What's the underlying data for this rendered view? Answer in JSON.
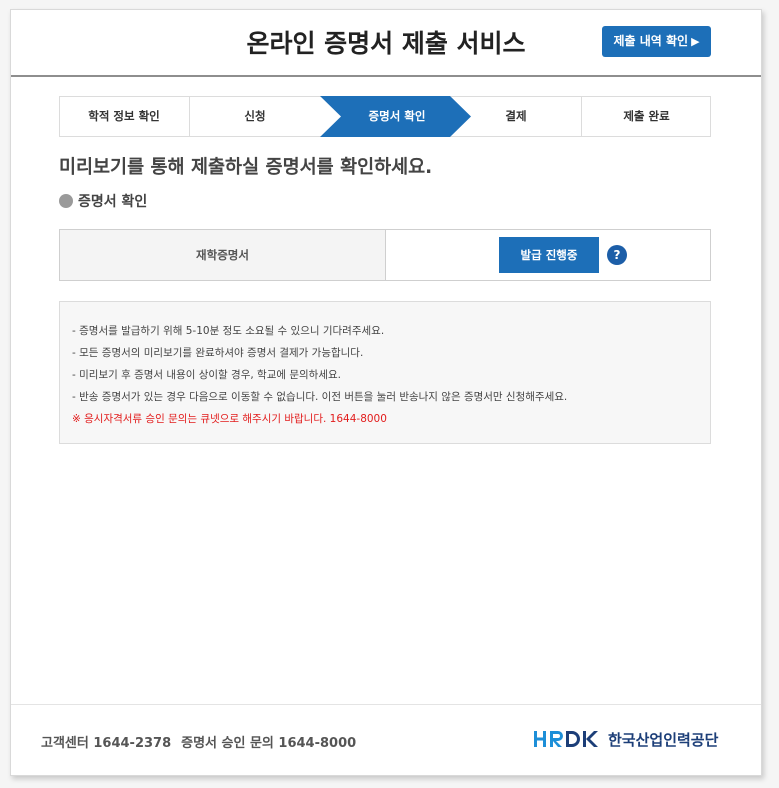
{
  "header": {
    "title": "온라인 증명서 제출 서비스",
    "history_button": "제출 내역 확인",
    "history_arrow": "▶"
  },
  "steps": [
    {
      "label": "학적 정보 확인",
      "active": false
    },
    {
      "label": "신청",
      "active": false
    },
    {
      "label": "증명서 확인",
      "active": true
    },
    {
      "label": "결제",
      "active": false
    },
    {
      "label": "제출 완료",
      "active": false
    }
  ],
  "main": {
    "heading": "미리보기를 통해 제출하실 증명서를 확인하세요.",
    "section_title": "증명서 확인",
    "certificate": {
      "name": "재학증명서",
      "status": "발급 진행중",
      "help": "?"
    },
    "notices": [
      "- 증명서를 발급하기 위해 5-10분 정도 소요될 수 있으니 기다려주세요.",
      "- 모든 증명서의 미리보기를 완료하셔야 증명서 결제가 가능합니다.",
      "- 미리보기 후 증명서 내용이 상이할 경우, 학교에 문의하세요.",
      "- 반송 증명서가 있는 경우 다음으로 이동할 수 없습니다. 이전 버튼을 눌러 반송나지 않은 증명서만 신청해주세요."
    ],
    "warning": "※ 응시자격서류 승인 문의는 큐넷으로 해주시기 바랍니다. 1644-8000"
  },
  "footer": {
    "customer_center": "고객센터 1644-2378",
    "approval_inquiry": "증명서 승인 문의 1644-8000",
    "logo_mark": "HRDK",
    "logo_org": "한국산업인력공단"
  },
  "colors": {
    "accent": "#1d6fb8",
    "warning": "#e21c1c",
    "logo": "#1c3e78"
  }
}
